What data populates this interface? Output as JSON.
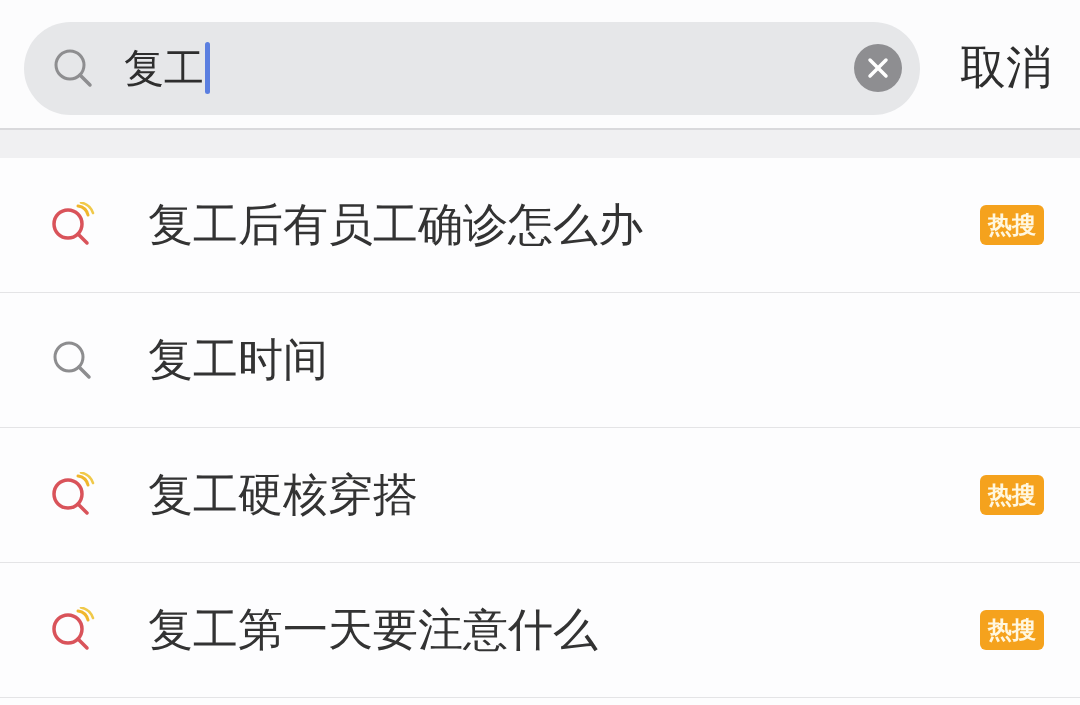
{
  "search_bar": {
    "query": "复工",
    "focused": true,
    "cancel": "取消"
  },
  "suggestions": [
    {
      "kind": "hot",
      "text": "复工后有员工确诊怎么办",
      "badge": "热搜"
    },
    {
      "kind": "plain",
      "text": "复工时间"
    },
    {
      "kind": "hot",
      "text": "复工硬核穿搭",
      "badge": "热搜"
    },
    {
      "kind": "hot",
      "text": "复工第一天要注意什么",
      "badge": "热搜"
    }
  ]
}
